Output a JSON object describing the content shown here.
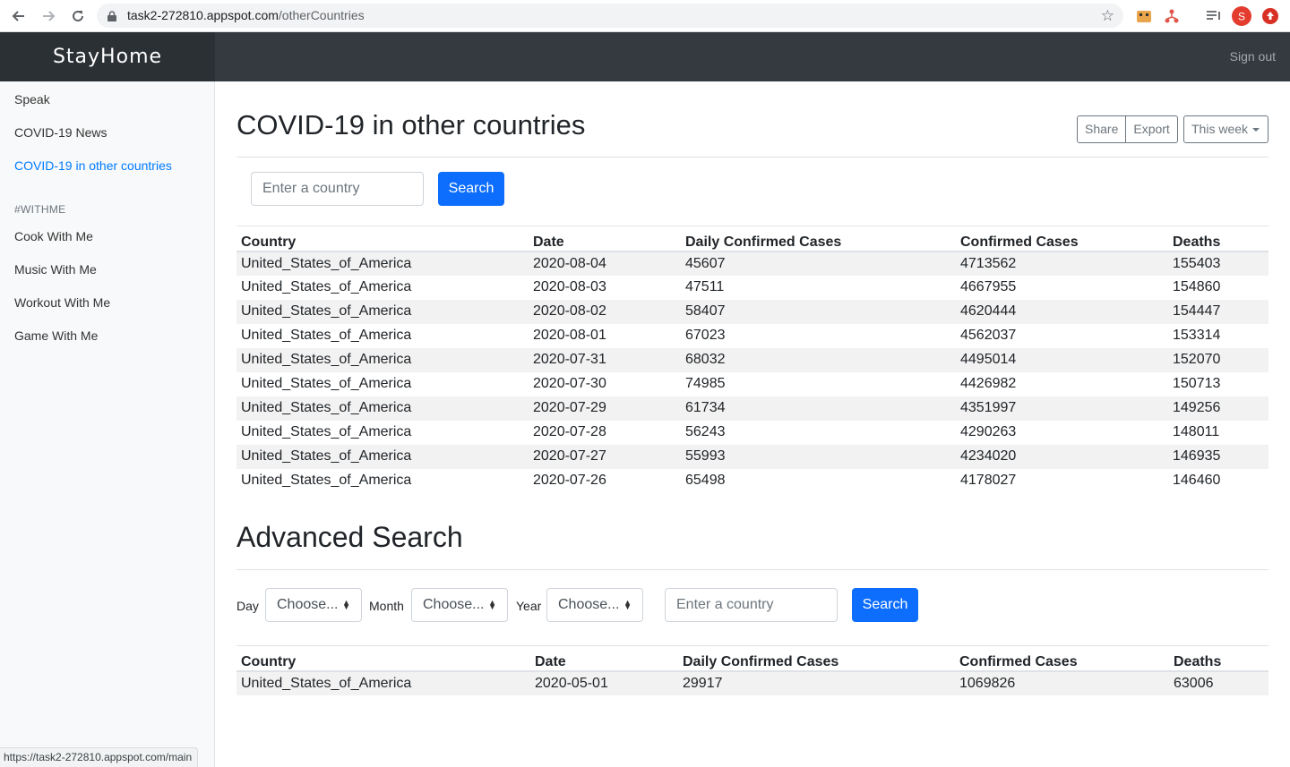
{
  "browser": {
    "url_host": "task2-272810.appspot.com",
    "url_path": "/otherCountries",
    "status_url": "https://task2-272810.appspot.com/main"
  },
  "navbar": {
    "brand": "StayHome",
    "signout": "Sign out"
  },
  "sidebar": {
    "items": [
      {
        "label": "Speak"
      },
      {
        "label": "COVID-19 News"
      },
      {
        "label": "COVID-19 in other countries"
      }
    ],
    "heading": "#WITHME",
    "withme_items": [
      {
        "label": "Cook With Me"
      },
      {
        "label": "Music With Me"
      },
      {
        "label": "Workout With Me"
      },
      {
        "label": "Game With Me"
      }
    ]
  },
  "main": {
    "title": "COVID-19 in other countries",
    "share": "Share",
    "export": "Export",
    "period": "This week",
    "search_placeholder": "Enter a country",
    "search_button": "Search",
    "table": {
      "headers": [
        "Country",
        "Date",
        "Daily Confirmed Cases",
        "Confirmed Cases",
        "Deaths"
      ],
      "rows": [
        [
          "United_States_of_America",
          "2020-08-04",
          "45607",
          "4713562",
          "155403"
        ],
        [
          "United_States_of_America",
          "2020-08-03",
          "47511",
          "4667955",
          "154860"
        ],
        [
          "United_States_of_America",
          "2020-08-02",
          "58407",
          "4620444",
          "154447"
        ],
        [
          "United_States_of_America",
          "2020-08-01",
          "67023",
          "4562037",
          "153314"
        ],
        [
          "United_States_of_America",
          "2020-07-31",
          "68032",
          "4495014",
          "152070"
        ],
        [
          "United_States_of_America",
          "2020-07-30",
          "74985",
          "4426982",
          "150713"
        ],
        [
          "United_States_of_America",
          "2020-07-29",
          "61734",
          "4351997",
          "149256"
        ],
        [
          "United_States_of_America",
          "2020-07-28",
          "56243",
          "4290263",
          "148011"
        ],
        [
          "United_States_of_America",
          "2020-07-27",
          "55993",
          "4234020",
          "146935"
        ],
        [
          "United_States_of_America",
          "2020-07-26",
          "65498",
          "4178027",
          "146460"
        ]
      ]
    }
  },
  "advanced": {
    "title": "Advanced Search",
    "day_label": "Day",
    "month_label": "Month",
    "year_label": "Year",
    "day_value": "Choose...",
    "month_value": "Choose...",
    "year_value": "Choose...",
    "search_placeholder": "Enter a country",
    "search_button": "Search",
    "table": {
      "headers": [
        "Country",
        "Date",
        "Daily Confirmed Cases",
        "Confirmed Cases",
        "Deaths"
      ],
      "rows": [
        [
          "United_States_of_America",
          "2020-05-01",
          "29917",
          "1069826",
          "63006"
        ]
      ]
    }
  }
}
